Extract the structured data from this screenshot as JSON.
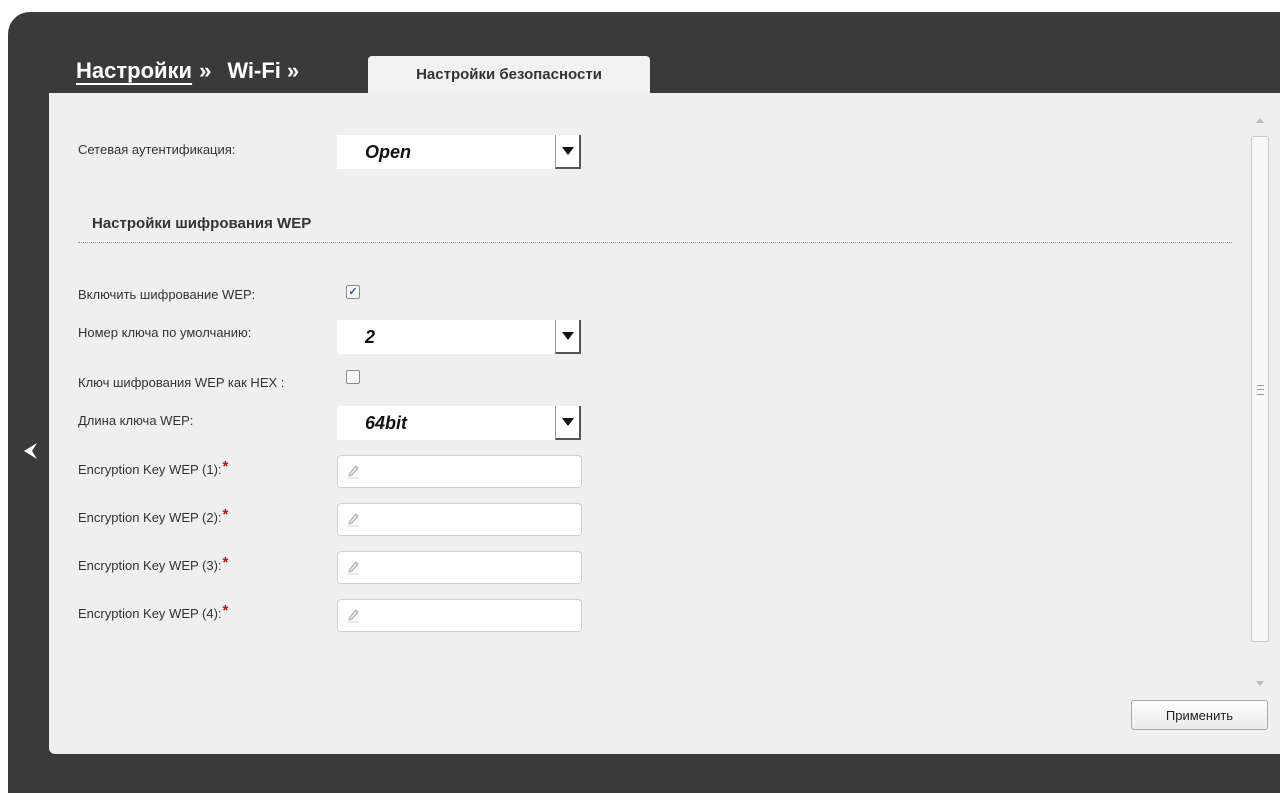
{
  "breadcrumb": {
    "settings": "Настройки",
    "sep1": "»",
    "wifi": "Wi-Fi",
    "sep2": "»"
  },
  "tab": {
    "label": "Настройки безопасности"
  },
  "form": {
    "network_auth": {
      "label": "Сетевая аутентификация:",
      "value": "Open"
    },
    "section_title": "Настройки шифрования WEP",
    "enable_wep": {
      "label": "Включить шифрование WEP:",
      "checked": true,
      "mark": "✓"
    },
    "default_key": {
      "label": "Номер ключа по умолчанию:",
      "value": "2"
    },
    "wep_hex": {
      "label": "Ключ шифрования WEP как HEX :",
      "checked": false
    },
    "key_length": {
      "label": "Длина ключа WEP:",
      "value": "64bit"
    },
    "keys": [
      {
        "label": "Encryption Key WEP (1):",
        "required": "*",
        "value": ""
      },
      {
        "label": "Encryption Key WEP (2):",
        "required": "*",
        "value": ""
      },
      {
        "label": "Encryption Key WEP (3):",
        "required": "*",
        "value": ""
      },
      {
        "label": "Encryption Key WEP (4):",
        "required": "*",
        "value": ""
      }
    ]
  },
  "buttons": {
    "apply": "Применить"
  },
  "icons": {
    "back": "chevron-left-icon",
    "dropdown": "triangle-down-icon",
    "input": "pencil-icon"
  },
  "colors": {
    "frame": "#3a3a3a",
    "panel": "#efefef",
    "required": "#e00000"
  }
}
